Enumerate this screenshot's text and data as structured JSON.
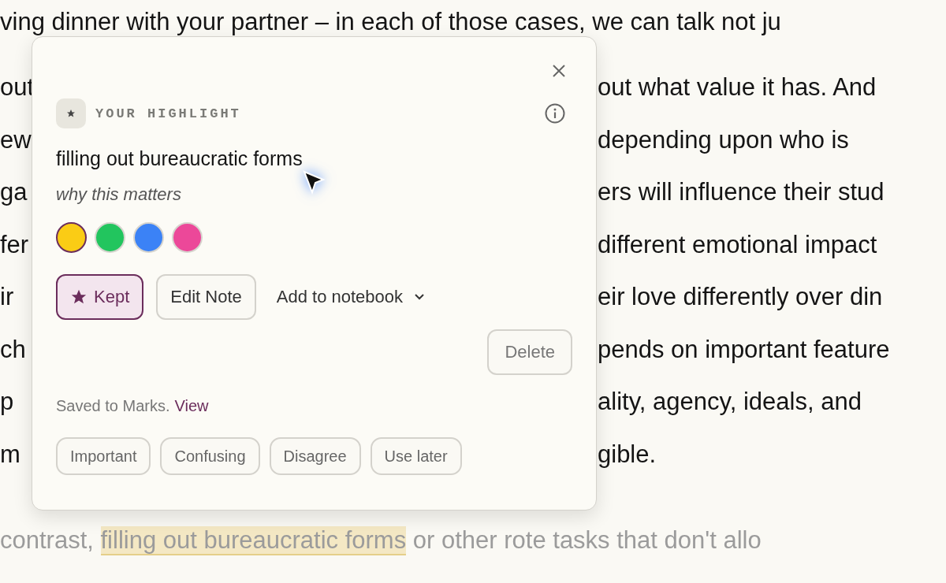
{
  "article": {
    "lead_line": "ving dinner with your partner – in each of those cases, we can talk not ju",
    "lines": [
      {
        "left": "out",
        "right": "out what value it has. And"
      },
      {
        "left": "ew",
        "right": "depending upon who is"
      },
      {
        "left": "ga",
        "right": "ers will influence their stud"
      },
      {
        "left": "fer",
        "right": "different emotional impact"
      },
      {
        "left": "ir",
        "right": "eir love differently over din"
      },
      {
        "left": "ch",
        "right": "pends on important feature"
      },
      {
        "left": "p",
        "right": "ality, agency, ideals, and"
      },
      {
        "left": "m",
        "right": "gible."
      }
    ],
    "final_line": {
      "before": "contrast, ",
      "highlight": "filling out bureaucratic forms",
      "after": " or other rote tasks that don't allo"
    }
  },
  "popup": {
    "label": "YOUR HIGHLIGHT",
    "quote": "filling out bureaucratic forms",
    "note_placeholder": "why this matters",
    "colors": [
      {
        "color": "#facc15",
        "selected": true
      },
      {
        "color": "#22c55e",
        "selected": false
      },
      {
        "color": "#3b82f6",
        "selected": false
      },
      {
        "color": "#ec4899",
        "selected": false
      }
    ],
    "keep_button": {
      "label": "Kept",
      "selected": true
    },
    "edit_button": "Edit Note",
    "notebook_dropdown": "Add to notebook",
    "delete_button": "Delete",
    "saved_text": "Saved to Marks.",
    "saved_link": "View",
    "tags": [
      "Important",
      "Confusing",
      "Disagree",
      "Use later"
    ]
  }
}
